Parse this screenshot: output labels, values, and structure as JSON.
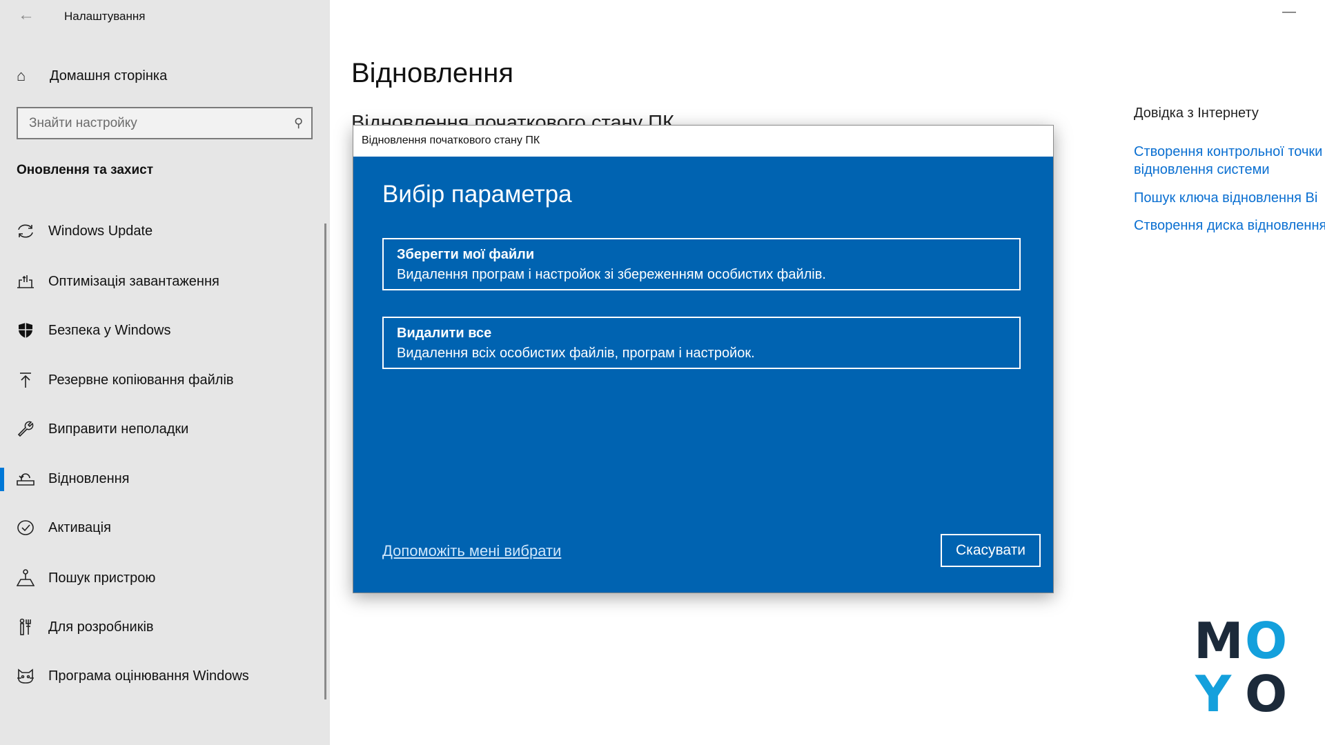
{
  "window": {
    "title": "Налаштування",
    "back_icon": "arrow-left-icon",
    "minimize_label": "—"
  },
  "sidebar": {
    "home": {
      "label": "Домашня сторінка",
      "icon": "home-icon"
    },
    "search": {
      "placeholder": "Знайти настройку",
      "value": ""
    },
    "section_title": "Оновлення та захист",
    "selected": "Відновлення",
    "accent": "#0078d7",
    "items": [
      {
        "label": "Windows Update",
        "icon": "sync-icon"
      },
      {
        "label": "Оптимізація завантаження",
        "icon": "delivery-optimization-icon"
      },
      {
        "label": "Безпека у Windows",
        "icon": "shield-icon"
      },
      {
        "label": "Резервне копіювання файлів",
        "icon": "backup-arrow-up-icon"
      },
      {
        "label": "Виправити неполадки",
        "icon": "wrench-icon"
      },
      {
        "label": "Відновлення",
        "icon": "recovery-icon"
      },
      {
        "label": "Активація",
        "icon": "check-circle-icon"
      },
      {
        "label": "Пошук пристрою",
        "icon": "find-device-icon"
      },
      {
        "label": "Для розробників",
        "icon": "developer-tools-icon"
      },
      {
        "label": "Програма оцінювання Windows",
        "icon": "insider-cat-icon"
      }
    ]
  },
  "main": {
    "title": "Відновлення",
    "subtitle": "Відновлення початкового стану ПК",
    "help": {
      "title": "Довідка з Інтернету",
      "links": [
        "Створення контрольної точки",
        "відновлення системи",
        "Пошук ключа відновлення Bi",
        "Створення диска відновлення"
      ]
    }
  },
  "dialog": {
    "title": "Відновлення початкового стану ПК",
    "heading": "Вибір параметра",
    "background": "#0063b1",
    "options": [
      {
        "title": "Зберегти мої файли",
        "description": "Видалення програм і настройок зі збереженням особистих файлів."
      },
      {
        "title": "Видалити все",
        "description": "Видалення всіх особистих файлів, програм і настройок."
      }
    ],
    "help_link": "Допоможіть мені вибрати",
    "cancel_label": "Скасувати"
  },
  "watermark": {
    "letters": [
      "M",
      "O",
      "Y",
      "O"
    ],
    "colors": {
      "dark": "#1c2a3a",
      "cyan": "#14a0dc"
    }
  }
}
